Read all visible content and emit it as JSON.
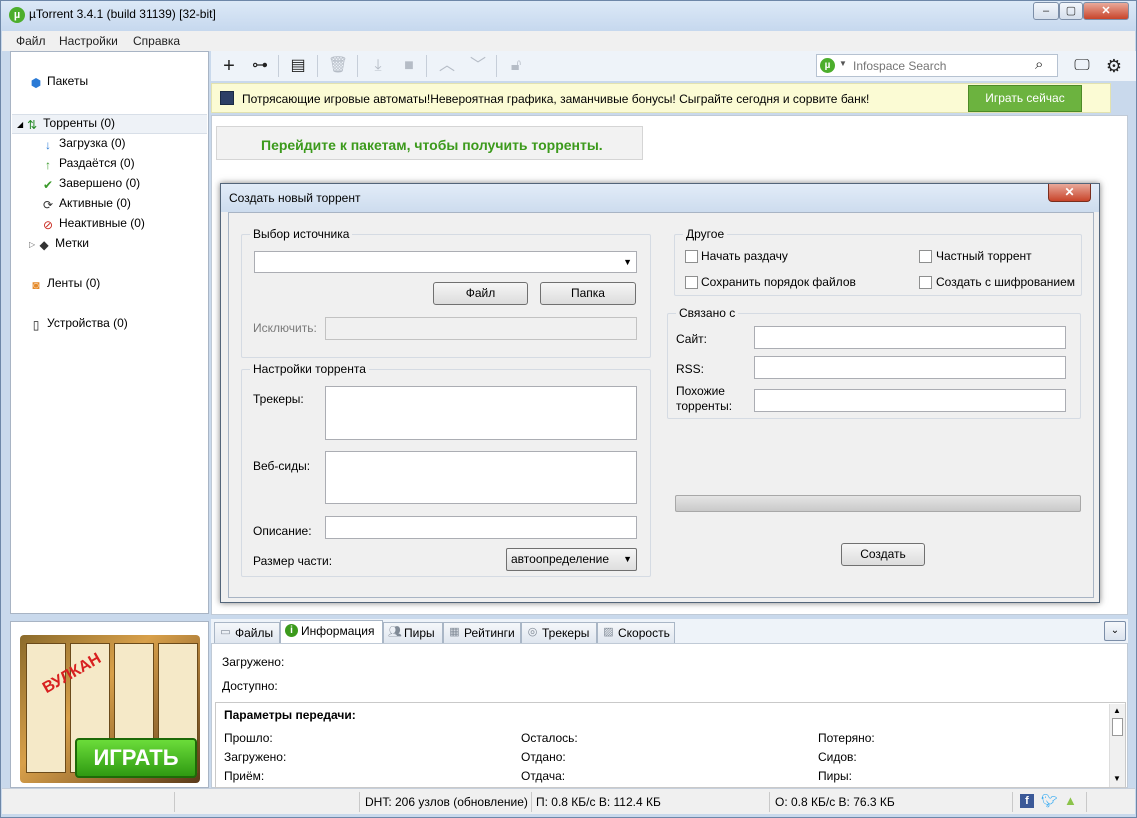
{
  "window": {
    "title": "µTorrent 3.4.1  (build 31139) [32-bit]",
    "app_icon_glyph": "µ"
  },
  "menu": [
    "Файл",
    "Настройки",
    "Справка"
  ],
  "sidebar": {
    "bundles": "Пакеты",
    "torrents": "Торренты (0)",
    "downloading": "Загрузка (0)",
    "seeding": "Раздаётся (0)",
    "completed": "Завершено (0)",
    "active": "Активные (0)",
    "inactive": "Неактивные (0)",
    "labels": "Метки",
    "feeds": "Ленты (0)",
    "devices": "Устройства (0)"
  },
  "sidebar_ad": {
    "logo": "ВУЛКАН",
    "play": "ИГРАТЬ"
  },
  "search": {
    "placeholder": "Infospace Search"
  },
  "ad_bar": {
    "message": "Потрясающие игровые автоматы!Невероятная графика, заманчивые бонусы! Сыграйте сегодня и сорвите банк!",
    "button": "Играть сейчас"
  },
  "main": {
    "hint": "Перейдите к пакетам, чтобы получить торренты."
  },
  "dialog": {
    "title": "Создать новый торрент",
    "source_group": "Выбор источника",
    "source_value": "",
    "file_button": "Файл",
    "folder_button": "Папка",
    "exclude_label": "Исключить:",
    "settings_group": "Настройки торрента",
    "trackers_label": "Трекеры:",
    "webseeds_label": "Веб-сиды:",
    "description_label": "Описание:",
    "piece_size_label": "Размер части:",
    "piece_size_value": "автоопределение",
    "other_group": "Другое",
    "start_seeding": "Начать раздачу",
    "private_torrent": "Частный торрент",
    "preserve_order": "Сохранить порядок файлов",
    "create_encrypted": "Создать с шифрованием",
    "related_group": "Связано с",
    "site_label": "Сайт:",
    "rss_label": "RSS:",
    "similar_label_1": "Похожие",
    "similar_label_2": "торренты:",
    "progress": 0,
    "create_button": "Создать"
  },
  "tabs": [
    "Файлы",
    "Информация",
    "Пиры",
    "Рейтинги",
    "Трекеры",
    "Скорость"
  ],
  "info": {
    "downloaded": "Загружено:",
    "available": "Доступно:",
    "transfer_header": "Параметры передачи:",
    "elapsed": "Прошло:",
    "remaining": "Осталось:",
    "wasted": "Потеряно:",
    "downloaded2": "Загружено:",
    "uploaded": "Отдано:",
    "seeds": "Сидов:",
    "receive": "Приём:",
    "send": "Отдача:",
    "peers": "Пиры:"
  },
  "status": {
    "dht": "DHT: 206 узлов  (обновление)",
    "download": "П: 0.8 КБ/с В: 112.4 КБ",
    "upload": "О: 0.8 КБ/с В: 76.3 КБ"
  },
  "colors": {
    "accent_green": "#3c9a1c",
    "ad_button": "#6cb33f",
    "ad_bar_bg": "#fbfbd4"
  }
}
